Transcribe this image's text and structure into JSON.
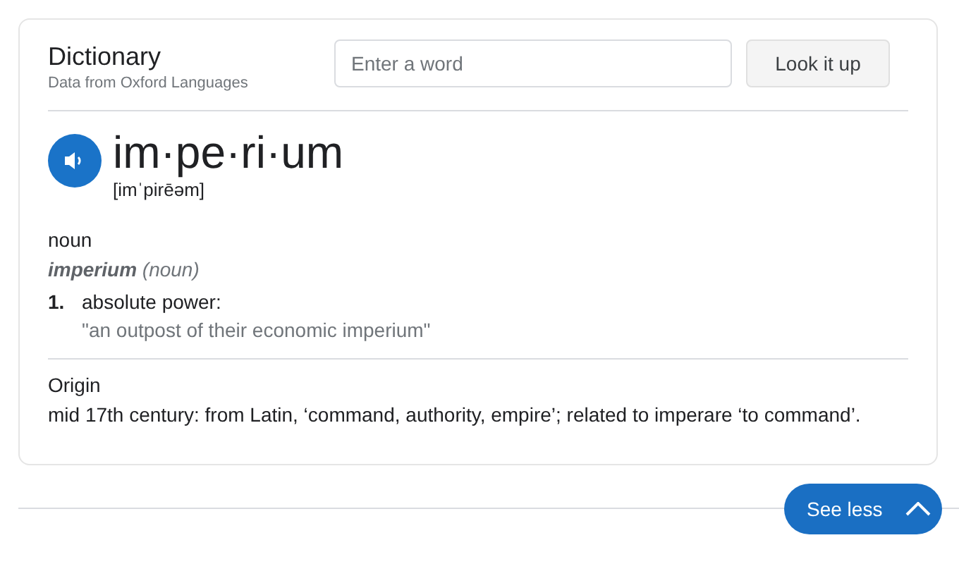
{
  "header": {
    "title": "Dictionary",
    "subtitle": "Data from Oxford Languages"
  },
  "search": {
    "placeholder": "Enter a word"
  },
  "lookup_button": "Look it up",
  "entry": {
    "headword": "im·pe·ri·um",
    "pronunciation": "[imˈpirēəm]",
    "part_of_speech": "noun",
    "form": "**imperium** (noun)",
    "senses": [
      {
        "number": "1.",
        "definition": "absolute power:",
        "example": "\"an outpost of their economic imperium\""
      }
    ]
  },
  "origin": {
    "label": "Origin",
    "text": "mid 17th century: from Latin, ‘command, authority, empire’; related to imperare ‘to command’."
  },
  "see_less_button": "See less"
}
